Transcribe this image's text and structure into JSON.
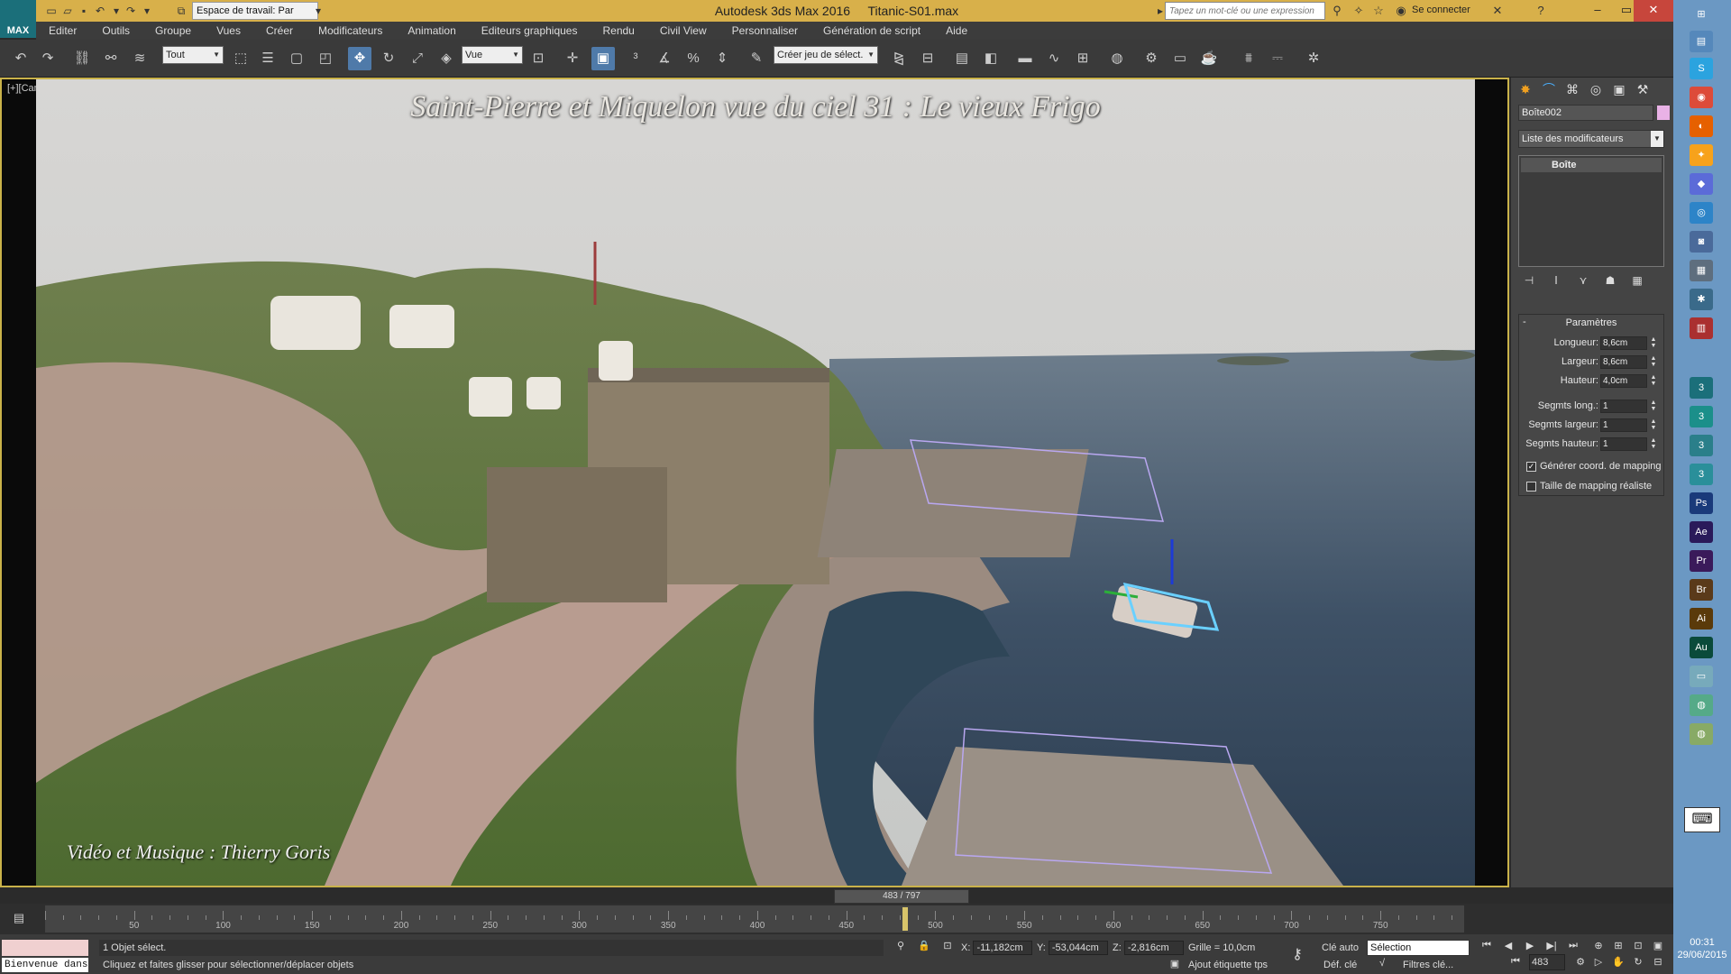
{
  "titlebar": {
    "app_title": "Autodesk 3ds Max 2016",
    "file_name": "Titanic-S01.max",
    "logo_text": "MAX",
    "workspace": "Espace de travail: Par",
    "search_placeholder": "Tapez un mot-clé ou une expression",
    "sign_in": "Se connecter"
  },
  "menu": [
    "Editer",
    "Outils",
    "Groupe",
    "Vues",
    "Créer",
    "Modificateurs",
    "Animation",
    "Editeurs graphiques",
    "Rendu",
    "Civil View",
    "Personnaliser",
    "Génération de script",
    "Aide"
  ],
  "toolbar": {
    "selection_filter": "Tout",
    "ref_coord": "Vue",
    "named_selection": "Créer jeu de sélect."
  },
  "viewport": {
    "label": "[+][Caméra][Tout]",
    "video_title": "Saint-Pierre et Miquelon vue du ciel 31 : Le vieux Frigo",
    "video_credit": "Vidéo et Musique : Thierry Goris"
  },
  "command_panel": {
    "object_name": "Boîte002",
    "object_color": "#e9b2e6",
    "modifier_list": "Liste des modificateurs",
    "stack_item": "Boîte",
    "params_title": "Paramètres",
    "params": [
      {
        "label": "Longueur:",
        "value": "8,6cm"
      },
      {
        "label": "Largeur:",
        "value": "8,6cm"
      },
      {
        "label": "Hauteur:",
        "value": "4,0cm"
      },
      {
        "label": "Segmts long.:",
        "value": "1"
      },
      {
        "label": "Segmts largeur:",
        "value": "1"
      },
      {
        "label": "Segmts hauteur:",
        "value": "1"
      }
    ],
    "gen_mapping": "Générer coord. de mapping",
    "real_mapping": "Taille de mapping réaliste"
  },
  "timeline": {
    "slider": "483 / 797",
    "current_frame": 483,
    "total_frames": 797,
    "ticks": [
      "50",
      "100",
      "150",
      "200",
      "250",
      "300",
      "350",
      "400",
      "450",
      "500",
      "550",
      "600",
      "650",
      "700",
      "750"
    ]
  },
  "status": {
    "welcome": "Bienvenue dans MAXScript.",
    "selected": "1 Objet sélect.",
    "prompt": "Cliquez et faites glisser pour sélectionner/déplacer objets",
    "x_label": "X:",
    "x": "-11,182cm",
    "y_label": "Y:",
    "y": "-53,044cm",
    "z_label": "Z:",
    "z": "-2,816cm",
    "grid": "Grille = 10,0cm",
    "add_time_tag": "Ajout étiquette tps",
    "auto_key": "Clé auto",
    "set_key": "Déf. clé",
    "selection_combo": "Sélection",
    "key_filters": "Filtres clé...",
    "frame": "483"
  },
  "taskbar": {
    "time": "00:31",
    "date": "29/06/2015"
  }
}
